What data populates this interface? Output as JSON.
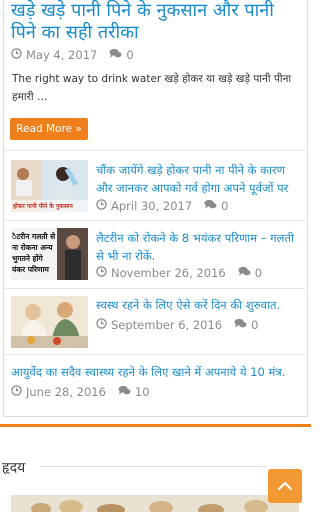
{
  "featured": {
    "title": "खड़े खड़े पानी पिने के नुकसान और पानी पिने का सही तरीका",
    "date": "May 4, 2017",
    "comments": "0",
    "excerpt": "The right way to drink water  खड़े होकर या खड़े खड़े पानी पीना हमारी …",
    "read_more": "Read More »"
  },
  "items": [
    {
      "title": "चौंक जायेंगे खड़े होकर पानी ना पीने के कारण और जानकर आपको गर्व होगा अपने पूर्वजों पर",
      "date": "April 30, 2017",
      "comments": "0",
      "thumb_text": "होकर पानी पीने के नुकसान"
    },
    {
      "title": "लैटरीन को रोकने के 8 भयंकर परिणाम – गलती से भी ना रोकें.",
      "date": "November 26, 2016",
      "comments": "0",
      "thumb_lines": [
        "ैटरीन गलती से",
        "ना रोकना अन्य",
        "भुगतने होंगे",
        "यंकर परिणाम"
      ]
    },
    {
      "title": "स्वस्थ रहने के लिए ऐसे करें दिन की शुरुवात.",
      "date": "September 6, 2016",
      "comments": "0"
    },
    {
      "title": "आयुर्वेद का सदैव स्वास्थ्य रहने के लिए खाने में अपनाये ये 10 मंत्र.",
      "date": "June 28, 2016",
      "comments": "10"
    }
  ],
  "section": {
    "title": "हृदय"
  },
  "colors": {
    "link": "#1a8bc9",
    "accent": "#ef7f1b",
    "meta": "#8a8a8a"
  },
  "icons": {
    "date": "clock-icon",
    "comments": "comment-icon",
    "scroll": "chevron-up-icon"
  }
}
